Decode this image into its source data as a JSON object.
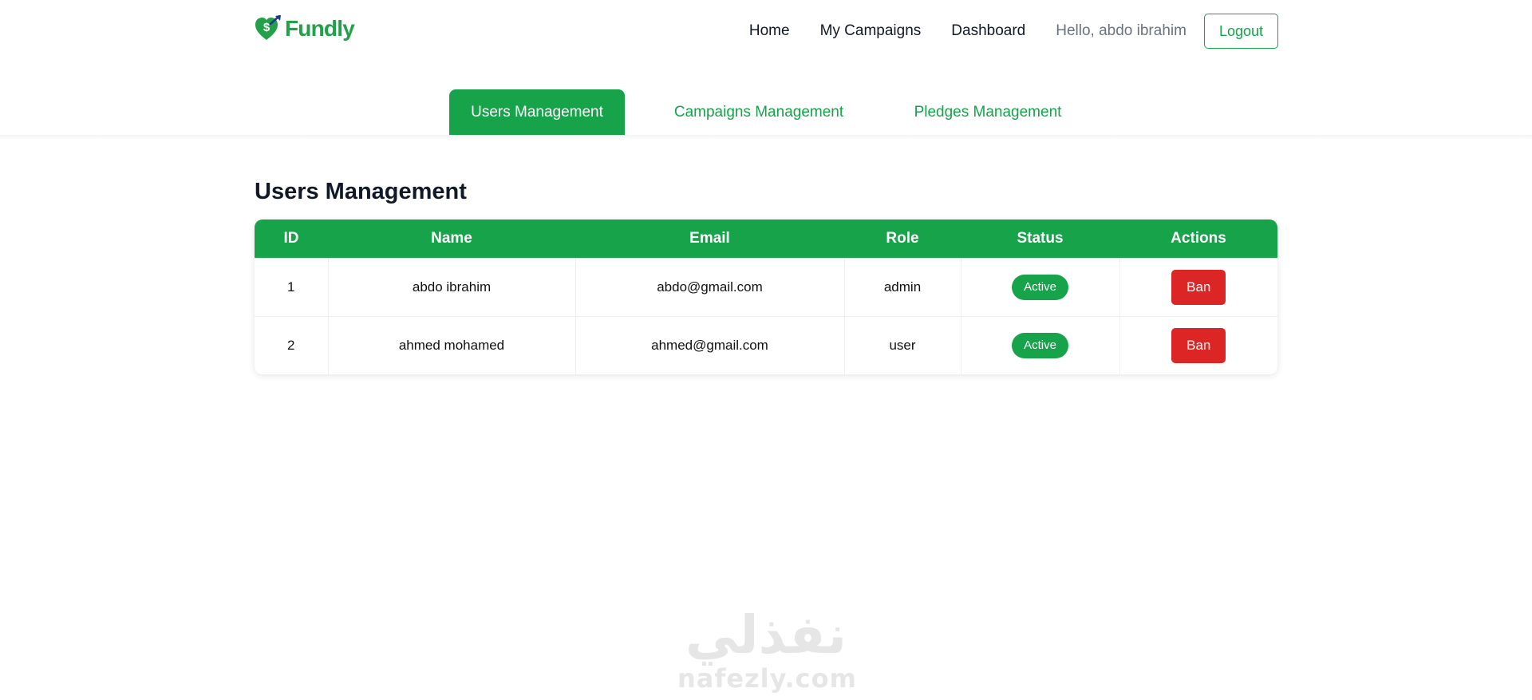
{
  "brand": {
    "name": "Fundly",
    "color": "#22a04a"
  },
  "nav": {
    "links": [
      "Home",
      "My Campaigns",
      "Dashboard"
    ],
    "greeting": "Hello, abdo ibrahim",
    "logout_label": "Logout"
  },
  "tabs": [
    {
      "label": "Users Management",
      "active": true
    },
    {
      "label": "Campaigns Management",
      "active": false
    },
    {
      "label": "Pledges Management",
      "active": false
    }
  ],
  "page": {
    "title": "Users Management"
  },
  "table": {
    "headers": [
      "ID",
      "Name",
      "Email",
      "Role",
      "Status",
      "Actions"
    ],
    "rows": [
      {
        "id": "1",
        "name": "abdo ibrahim",
        "email": "abdo@gmail.com",
        "role": "admin",
        "status": "Active",
        "action": "Ban"
      },
      {
        "id": "2",
        "name": "ahmed mohamed",
        "email": "ahmed@gmail.com",
        "role": "user",
        "status": "Active",
        "action": "Ban"
      }
    ]
  },
  "watermark": {
    "arabic": "نفذلي",
    "latin": "nafezly.com"
  },
  "colors": {
    "primary": "#16a34a",
    "danger": "#dc2626",
    "muted": "#6b7280"
  }
}
